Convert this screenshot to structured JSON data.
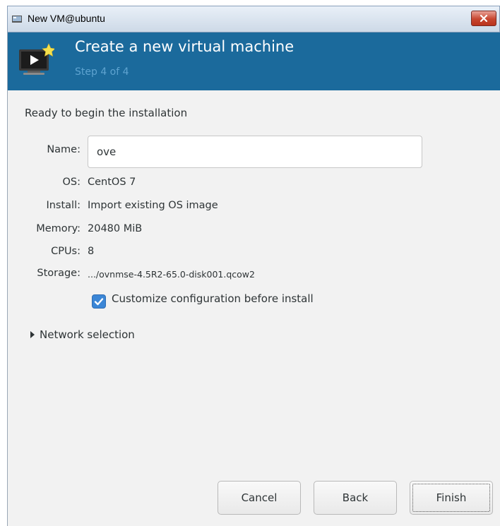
{
  "window": {
    "title": "New VM@ubuntu"
  },
  "header": {
    "title": "Create a new virtual machine",
    "step": "Step 4 of 4"
  },
  "ready_text": "Ready to begin the installation",
  "fields": {
    "name": {
      "label": "Name:",
      "value": "ove"
    },
    "os": {
      "label": "OS:",
      "value": "CentOS 7"
    },
    "install": {
      "label": "Install:",
      "value": "Import existing OS image"
    },
    "memory": {
      "label": "Memory:",
      "value": "20480 MiB"
    },
    "cpus": {
      "label": "CPUs:",
      "value": "8"
    },
    "storage": {
      "label": "Storage:",
      "value": ".../ovnmse-4.5R2-65.0-disk001.qcow2"
    }
  },
  "customize": {
    "label": "Customize configuration before install",
    "checked": true
  },
  "network": {
    "label": "Network selection"
  },
  "buttons": {
    "cancel": "Cancel",
    "back": "Back",
    "finish": "Finish"
  },
  "colors": {
    "header_bg": "#1b6a9c",
    "step_text": "#5ea3d0",
    "checkbox": "#3b86d6"
  }
}
